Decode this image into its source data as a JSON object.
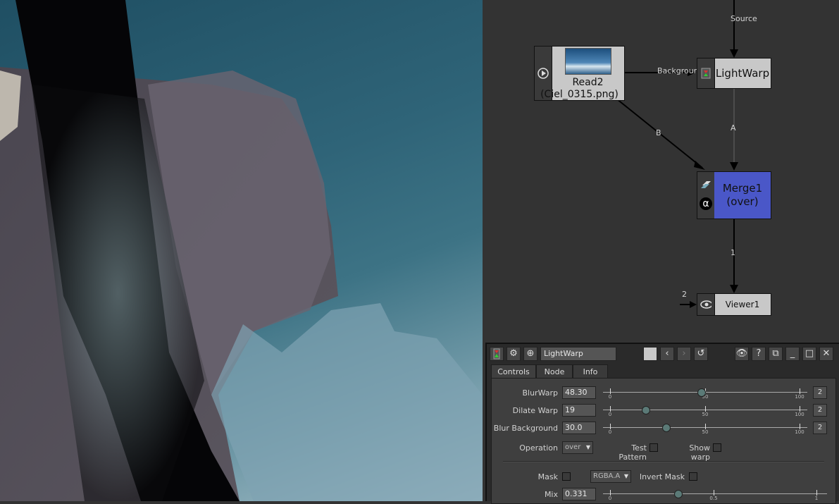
{
  "graph": {
    "labels": {
      "source": "Source",
      "background": "Background",
      "b": "B",
      "a": "A",
      "one": "1",
      "two": "2"
    },
    "nodes": {
      "read2": {
        "line1": "Read2",
        "line2": "(Ciel_0315.png)"
      },
      "lightwarp": {
        "label": "LightWarp"
      },
      "merge1": {
        "line1": "Merge1",
        "line2": "(over)",
        "color": "#4a57c8"
      },
      "viewer1": {
        "label": "Viewer1"
      }
    }
  },
  "properties": {
    "node_name": "LightWarp",
    "tabs": [
      "Controls",
      "Node",
      "Info"
    ],
    "params": [
      {
        "label": "BlurWarp",
        "value": "48.30",
        "ticks": [
          "0",
          "50",
          "100"
        ],
        "knob": 0.483,
        "anim": "2"
      },
      {
        "label": "Dilate Warp",
        "value": "19",
        "ticks": [
          "0",
          "50",
          "100"
        ],
        "knob": 0.19,
        "anim": "2"
      },
      {
        "label": "Blur Background",
        "value": "30.0",
        "ticks": [
          "0",
          "50",
          "100"
        ],
        "knob": 0.3,
        "anim": "2"
      }
    ],
    "operation": {
      "label": "Operation",
      "value": "over"
    },
    "test_pattern": "Test Pattern",
    "show_warp": "Show warp",
    "mask": {
      "label": "Mask",
      "channel": "RGBA.A",
      "invert": "Invert Mask"
    },
    "mix": {
      "label": "Mix",
      "value": "0.331",
      "ticks": [
        "0",
        "0.5",
        "1"
      ],
      "knob": 0.331
    }
  }
}
